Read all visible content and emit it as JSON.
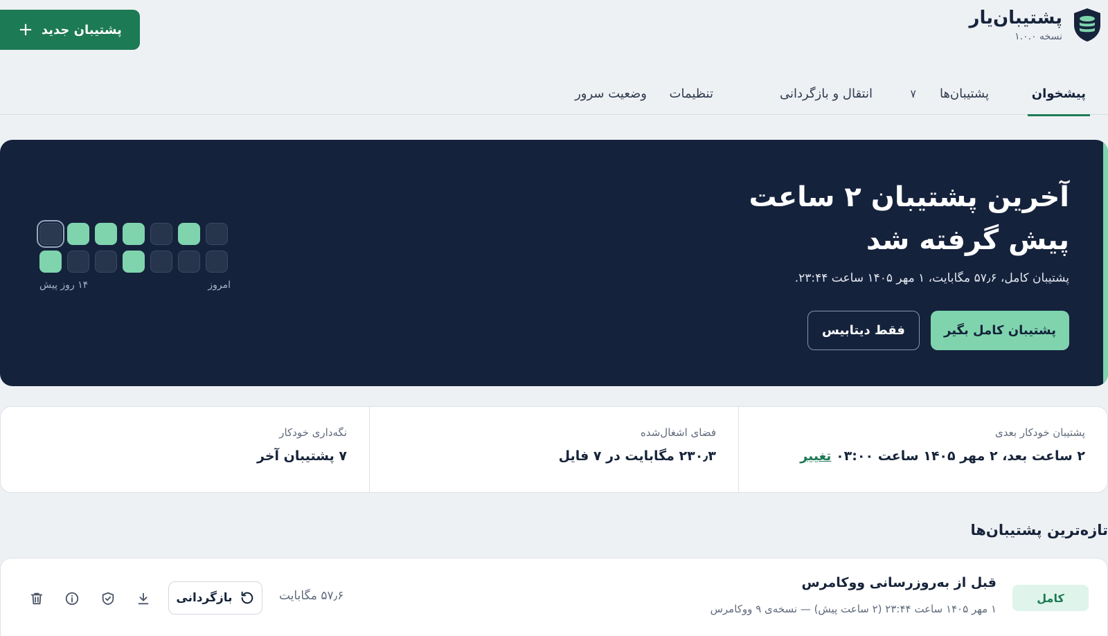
{
  "app": {
    "title": "پشتیبان‌یار",
    "version": "نسخه ۱.۰.۰",
    "new_backup_label": "پشتیبان جدید"
  },
  "tabs": [
    {
      "label": "پیشخوان",
      "active": true
    },
    {
      "label": "پشتیبان‌ها",
      "count": "۷"
    },
    {
      "label": "انتقال و بازگردانی"
    },
    {
      "label": "تنظیمات"
    },
    {
      "label": "وضعیت سرور"
    }
  ],
  "hero": {
    "title": "آخرین پشتیبان ۲ ساعت پیش گرفته شد",
    "subtitle": "پشتیبان کامل، ۵۷٫۶ مگابایت، ۱ مهر ۱۴۰۵ ساعت ۲۳:۴۴.",
    "primary_action": "پشتیبان کامل بگیر",
    "secondary_action": "فقط دیتابیس",
    "calendar": {
      "label_today": "امروز",
      "label_oldest": "۱۴ روز پیش",
      "row1": [
        true,
        false,
        true,
        true,
        true,
        false,
        false
      ],
      "row2": [
        true,
        false,
        false,
        true,
        false,
        false,
        false
      ]
    }
  },
  "stats": [
    {
      "label": "پشتیبان خودکار بعدی",
      "value": "۲ ساعت بعد، ۲ مهر ۱۴۰۵ ساعت ۰۳:۰۰",
      "link": "تغییر"
    },
    {
      "label": "فضای اشغال‌شده",
      "value": "۲۳۰٫۳ مگابایت در ۷ فایل"
    },
    {
      "label": "نگه‌داری خودکار",
      "value": "۷ پشتیبان آخر"
    }
  ],
  "recent": {
    "title": "تازه‌ترین پشتیبان‌ها",
    "items": [
      {
        "badge": "کامل",
        "name": "قبل از به‌روزرسانی ووکامرس",
        "meta": "۱ مهر ۱۴۰۵ ساعت ۲۳:۴۴ (۲ ساعت پیش) — نسخه‌ی ۹ ووکامرس",
        "size": "۵۷٫۶ مگابایت",
        "restore_label": "بازگردانی"
      }
    ]
  },
  "colors": {
    "brand": "#1c7a54",
    "hero_bg": "#15223c",
    "accent": "#7fd4ae"
  }
}
